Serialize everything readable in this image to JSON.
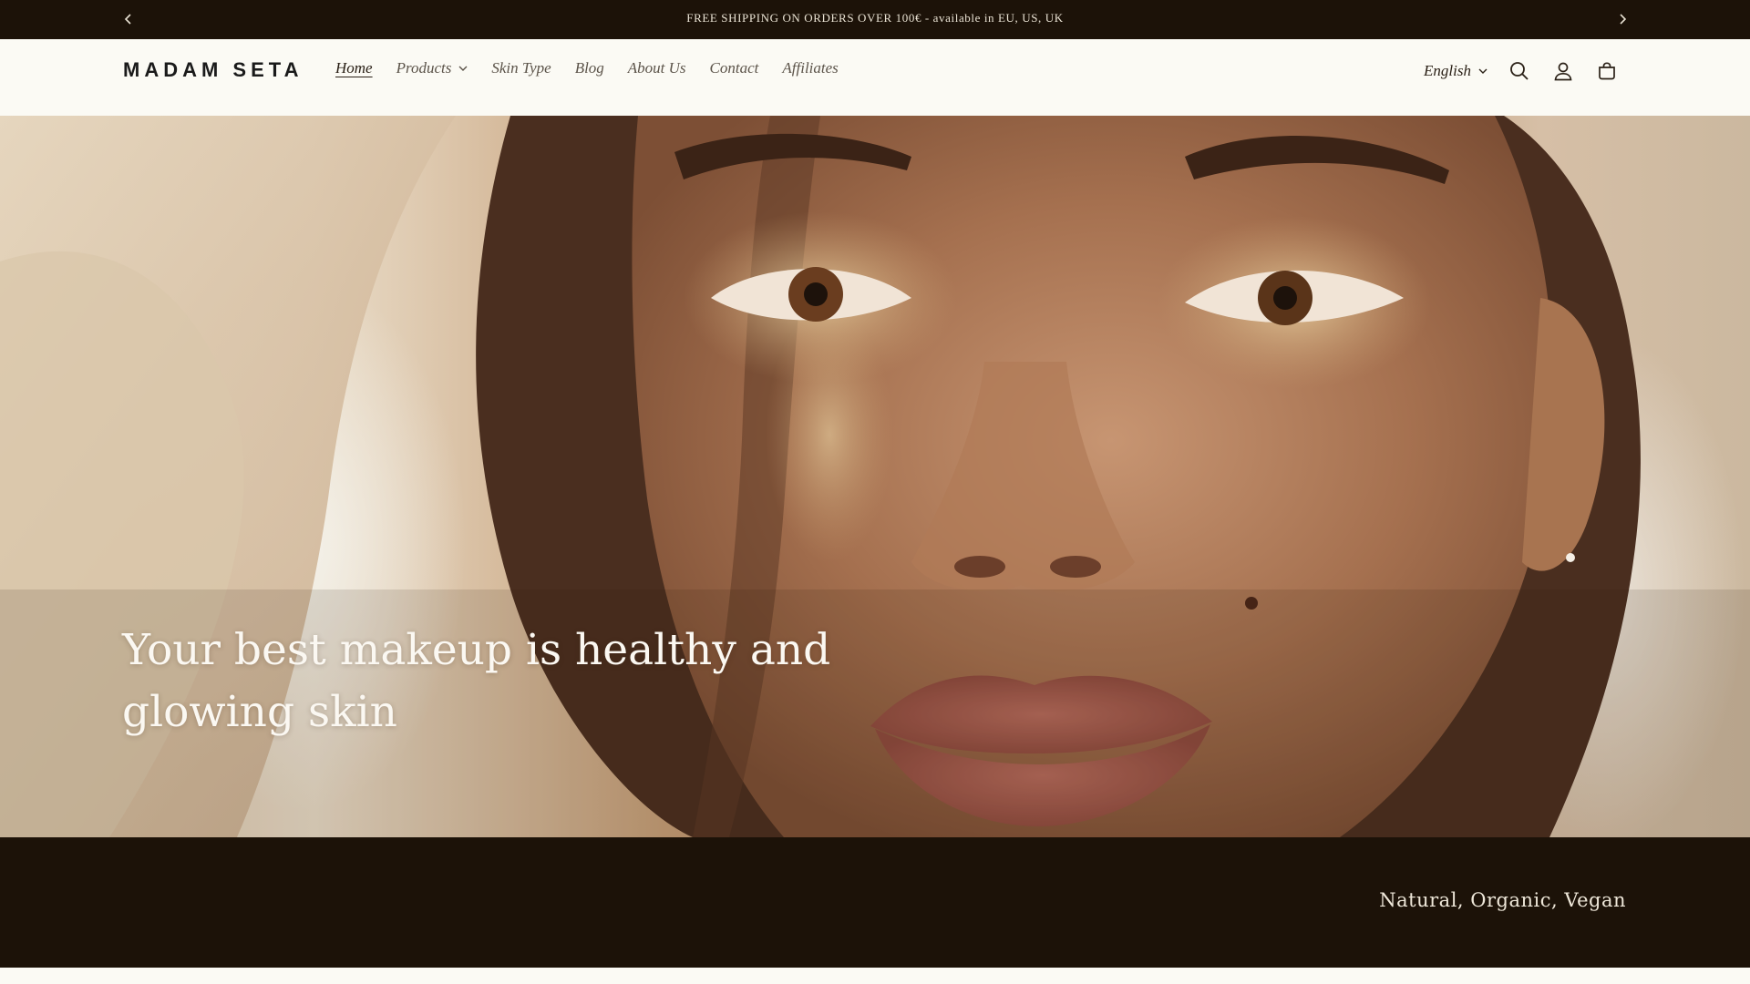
{
  "announcement": {
    "text": "FREE SHIPPING ON ORDERS OVER 100€ - available in EU, US, UK",
    "prev_icon": "chevron-left-icon",
    "next_icon": "chevron-right-icon"
  },
  "header": {
    "logo": "MADAM SETA",
    "nav": [
      {
        "label": "Home",
        "active": true
      },
      {
        "label": "Products",
        "has_dropdown": true
      },
      {
        "label": "Skin Type"
      },
      {
        "label": "Blog"
      },
      {
        "label": "About Us"
      },
      {
        "label": "Contact"
      },
      {
        "label": "Affiliates"
      }
    ],
    "language": "English",
    "icons": [
      "search-icon",
      "account-icon",
      "cart-icon"
    ]
  },
  "hero": {
    "heading": "Your best makeup is healthy and glowing skin"
  },
  "band": {
    "text": "Natural, Organic, Vegan"
  },
  "colors": {
    "dark": "#1c1208",
    "cream": "#fbfaf4",
    "text": "#2a2016"
  }
}
